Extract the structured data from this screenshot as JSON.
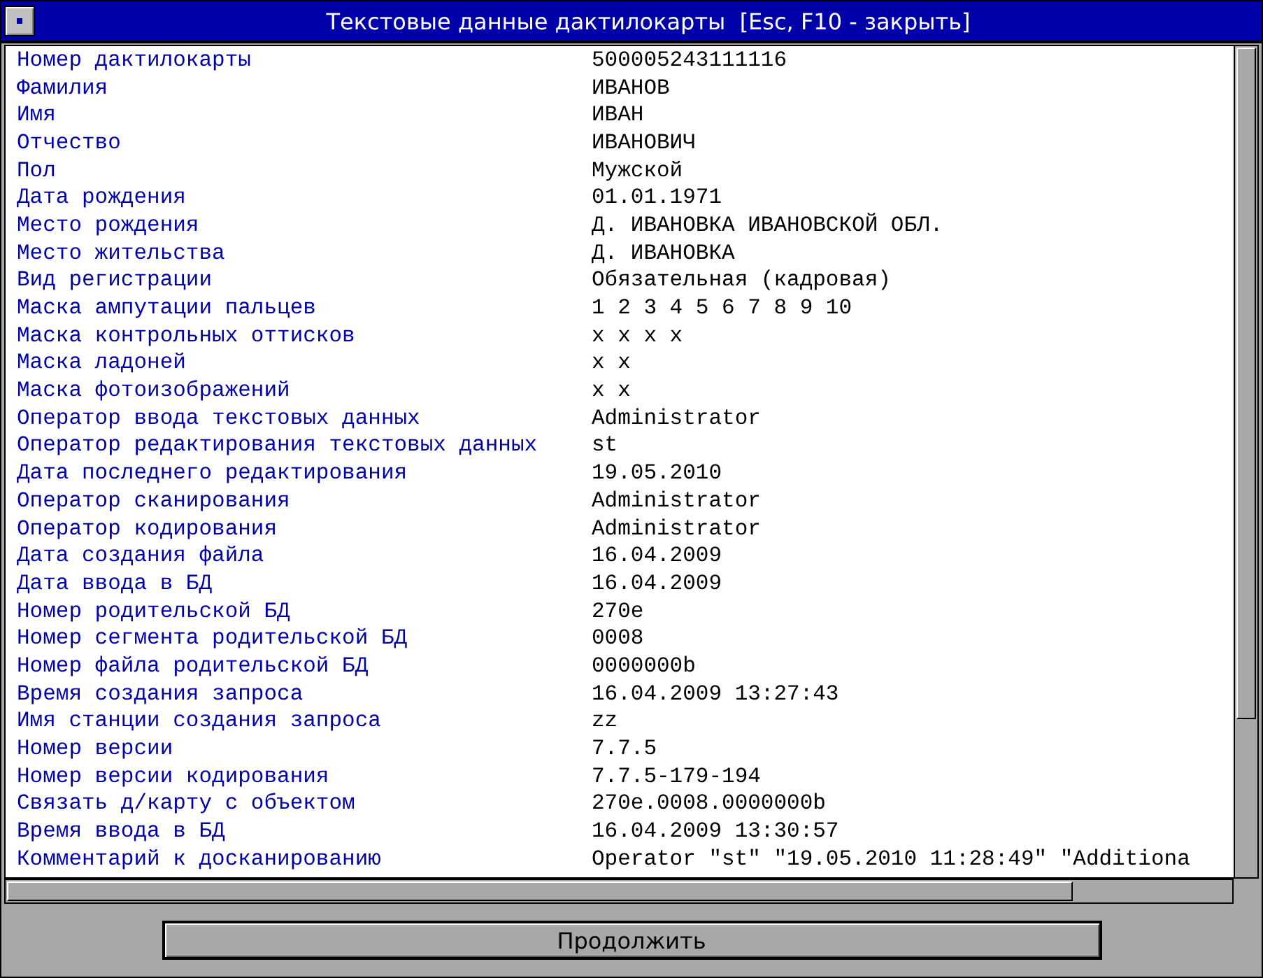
{
  "window": {
    "title": "Текстовые данные дактилокарты  [Esc, F10 - закрыть]"
  },
  "fields": [
    {
      "label": "Номер дактилокарты",
      "value": "500005243111116"
    },
    {
      "label": "Фамилия",
      "value": "ИВАНОВ"
    },
    {
      "label": "Имя",
      "value": "ИВАН"
    },
    {
      "label": "Отчество",
      "value": "ИВАНОВИЧ"
    },
    {
      "label": "Пол",
      "value": "Мужской"
    },
    {
      "label": "Дата рождения",
      "value": "01.01.1971"
    },
    {
      "label": "Место рождения",
      "value": "Д. ИВАНОВКА ИВАНОВСКОЙ ОБЛ."
    },
    {
      "label": "Место жительства",
      "value": "Д. ИВАНОВКА"
    },
    {
      "label": "Вид регистрации",
      "value": "Обязательная (кадровая)"
    },
    {
      "label": "Маска ампутации пальцев",
      "value": "1 2 3 4 5 6 7 8 9 10"
    },
    {
      "label": "Маска контрольных оттисков",
      "value": "x x x x"
    },
    {
      "label": "Маска ладоней",
      "value": "x x"
    },
    {
      "label": "Маска фотоизображений",
      "value": "x x"
    },
    {
      "label": "Оператор ввода текстовых данных",
      "value": "Administrator"
    },
    {
      "label": "Оператор редактирования текстовых данных",
      "value": "st"
    },
    {
      "label": "Дата последнего редактирования",
      "value": "19.05.2010"
    },
    {
      "label": "Оператор сканирования",
      "value": "Administrator"
    },
    {
      "label": "Оператор кодирования",
      "value": "Administrator"
    },
    {
      "label": "Дата создания файла",
      "value": "16.04.2009"
    },
    {
      "label": "Дата ввода в БД",
      "value": "16.04.2009"
    },
    {
      "label": "Номер родительской БД",
      "value": "270e"
    },
    {
      "label": "Номер сегмента родительской БД",
      "value": "0008"
    },
    {
      "label": "Номер файла родительской БД",
      "value": "0000000b"
    },
    {
      "label": "Время создания запроса",
      "value": "16.04.2009 13:27:43"
    },
    {
      "label": "Имя станции создания запроса",
      "value": "zz"
    },
    {
      "label": "Номер версии",
      "value": "7.7.5"
    },
    {
      "label": "Номер версии кодирования",
      "value": "7.7.5-179-194"
    },
    {
      "label": "Связать д/карту с объектом",
      "value": "270e.0008.0000000b"
    },
    {
      "label": "Время ввода в БД",
      "value": "16.04.2009 13:30:57"
    },
    {
      "label": "Комментарий к досканированию",
      "value": "Operator \"st\" \"19.05.2010 11:28:49\" \"Additiona"
    }
  ],
  "buttons": [
    "Продолжить"
  ]
}
